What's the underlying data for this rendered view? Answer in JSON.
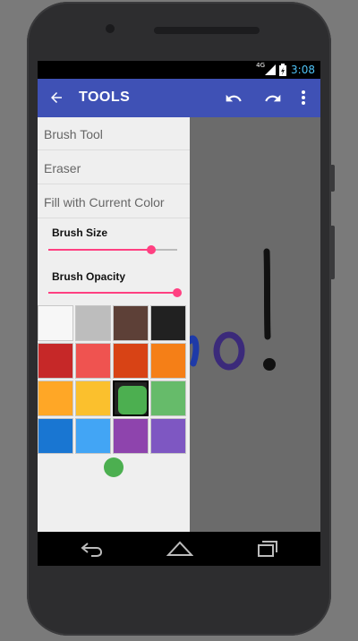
{
  "status_bar": {
    "time": "3:08",
    "network": "4G",
    "signal_icon": "signal-icon",
    "battery_icon": "battery-charging-icon"
  },
  "app_bar": {
    "title": "TOOLS",
    "back_icon": "arrow-back-icon",
    "undo_icon": "undo-icon",
    "redo_icon": "redo-icon",
    "overflow_icon": "more-vert-icon",
    "color": "#3f51b5"
  },
  "drawer": {
    "menu": [
      {
        "label": "Brush Tool"
      },
      {
        "label": "Eraser"
      },
      {
        "label": "Fill with Current Color"
      }
    ],
    "sliders": [
      {
        "label": "Brush Size",
        "value_percent": 80
      },
      {
        "label": "Brush Opacity",
        "value_percent": 100
      }
    ],
    "slider_color": "#ff4081",
    "palette": [
      "#f7f7f7",
      "#bdbdbd",
      "#5d4037",
      "#212121",
      "#c62828",
      "#ef5350",
      "#d84315",
      "#f57f17",
      "#ffa726",
      "#fbc02d",
      "#4caf50",
      "#66bb6a",
      "#1976d2",
      "#42a5f5",
      "#8e44ad",
      "#7e57c2"
    ],
    "selected_color": "#4caf50",
    "current_color": "#4caf50"
  },
  "nav_bar": {
    "back_icon": "nav-back-icon",
    "home_icon": "nav-home-icon",
    "recents_icon": "nav-recents-icon"
  }
}
